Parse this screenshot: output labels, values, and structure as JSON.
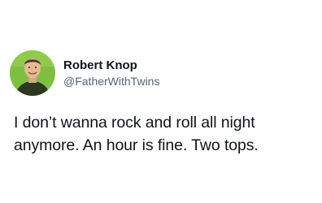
{
  "tweet": {
    "author": {
      "display_name": "Robert Knop",
      "handle": "@FatherWithTwins",
      "avatar_icon": "profile-photo-avatar"
    },
    "text_line1": "I don’t wanna rock and roll all night",
    "text_line2": "anymore. An hour is fine. Two tops."
  },
  "colors": {
    "background": "#ffffff",
    "text_primary": "#0f1419",
    "text_secondary": "#536471",
    "avatar_background": "#7fbf3f"
  }
}
